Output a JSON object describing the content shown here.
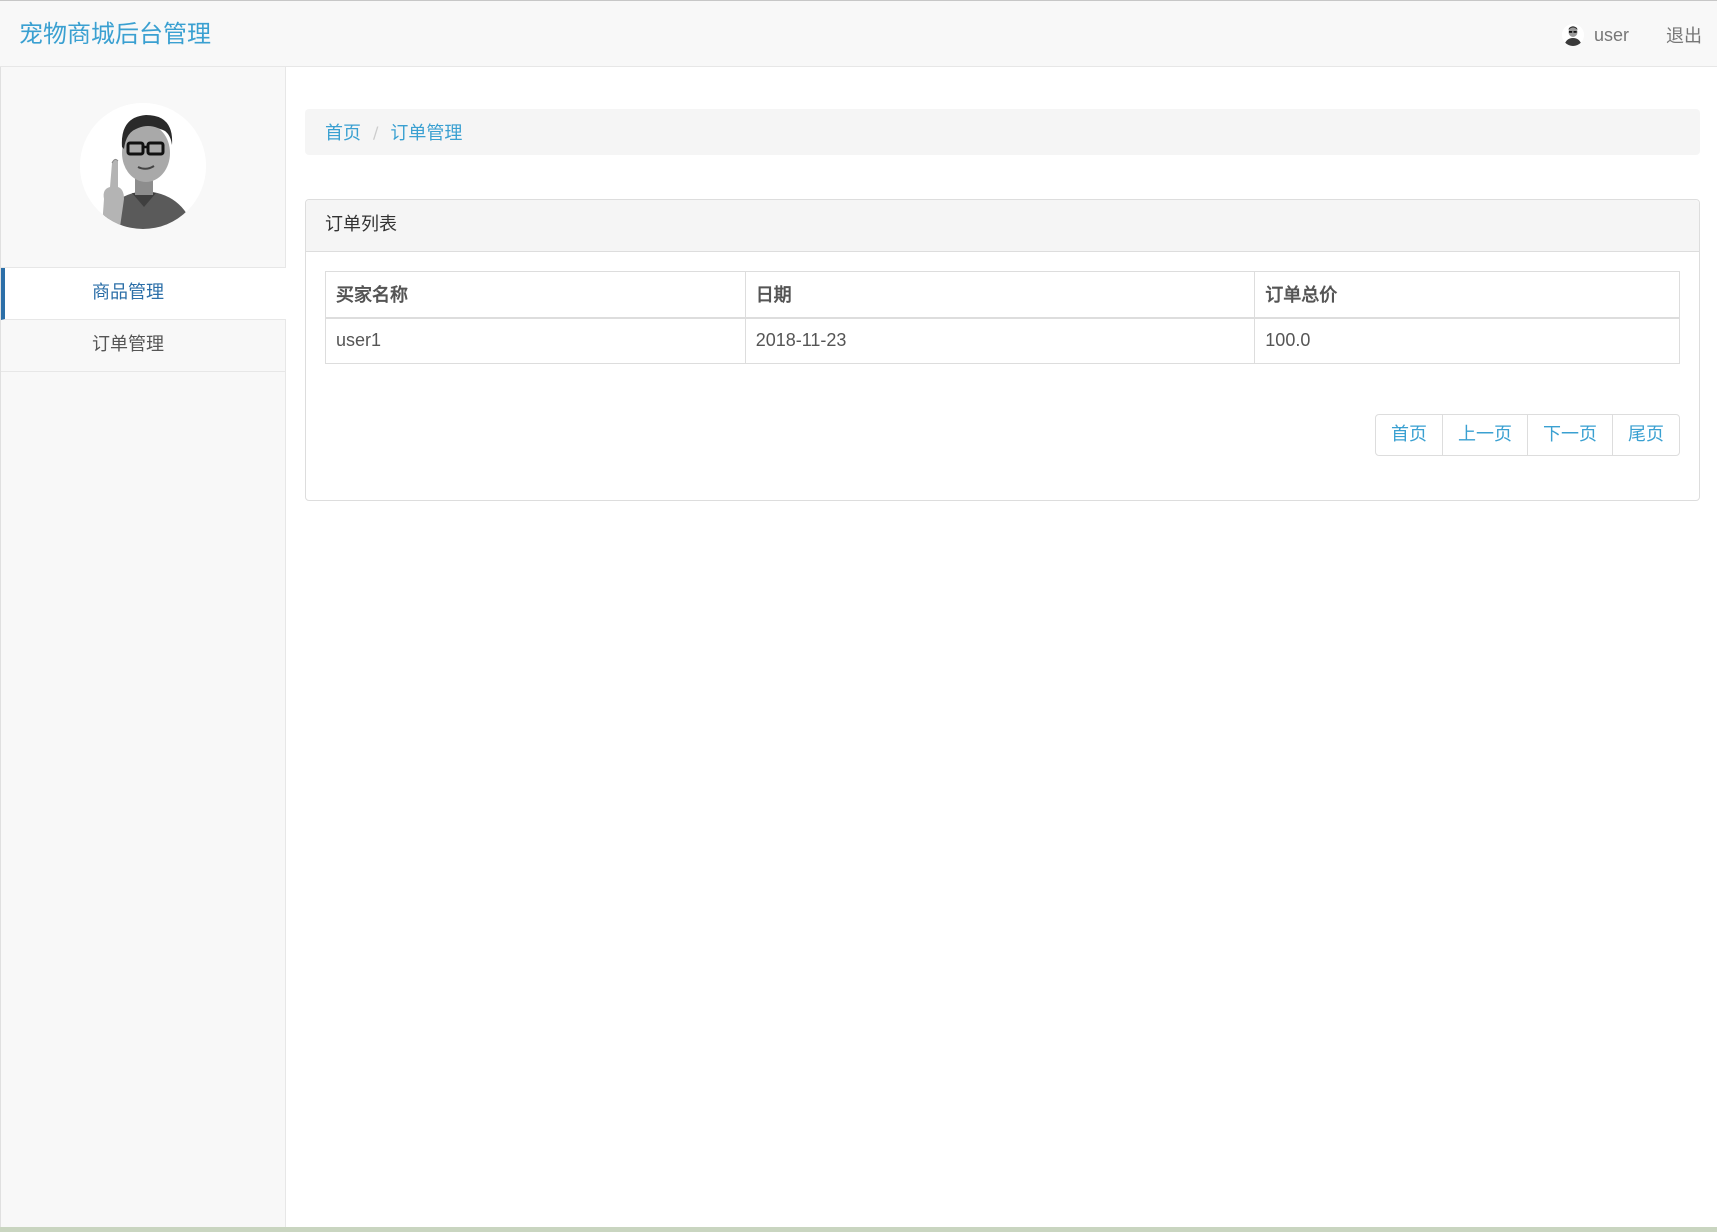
{
  "navbar": {
    "brand": "宠物商城后台管理",
    "user_name": "user",
    "logout_label": "退出"
  },
  "sidebar": {
    "items": [
      {
        "label": "商品管理",
        "active": true
      },
      {
        "label": "订单管理",
        "active": false
      }
    ]
  },
  "breadcrumb": {
    "home": "首页",
    "separator": "/",
    "current": "订单管理"
  },
  "panel": {
    "title": "订单列表"
  },
  "table": {
    "headers": [
      "买家名称",
      "日期",
      "订单总价"
    ],
    "rows": [
      [
        "user1",
        "2018-11-23",
        "100.0"
      ]
    ]
  },
  "pagination": {
    "first": "首页",
    "prev": "上一页",
    "next": "下一页",
    "last": "尾页"
  },
  "colors": {
    "brand": "#3aa0d1",
    "link": "#3aa0d1",
    "active_menu": "#2c6fa8",
    "border": "#dddddd"
  }
}
